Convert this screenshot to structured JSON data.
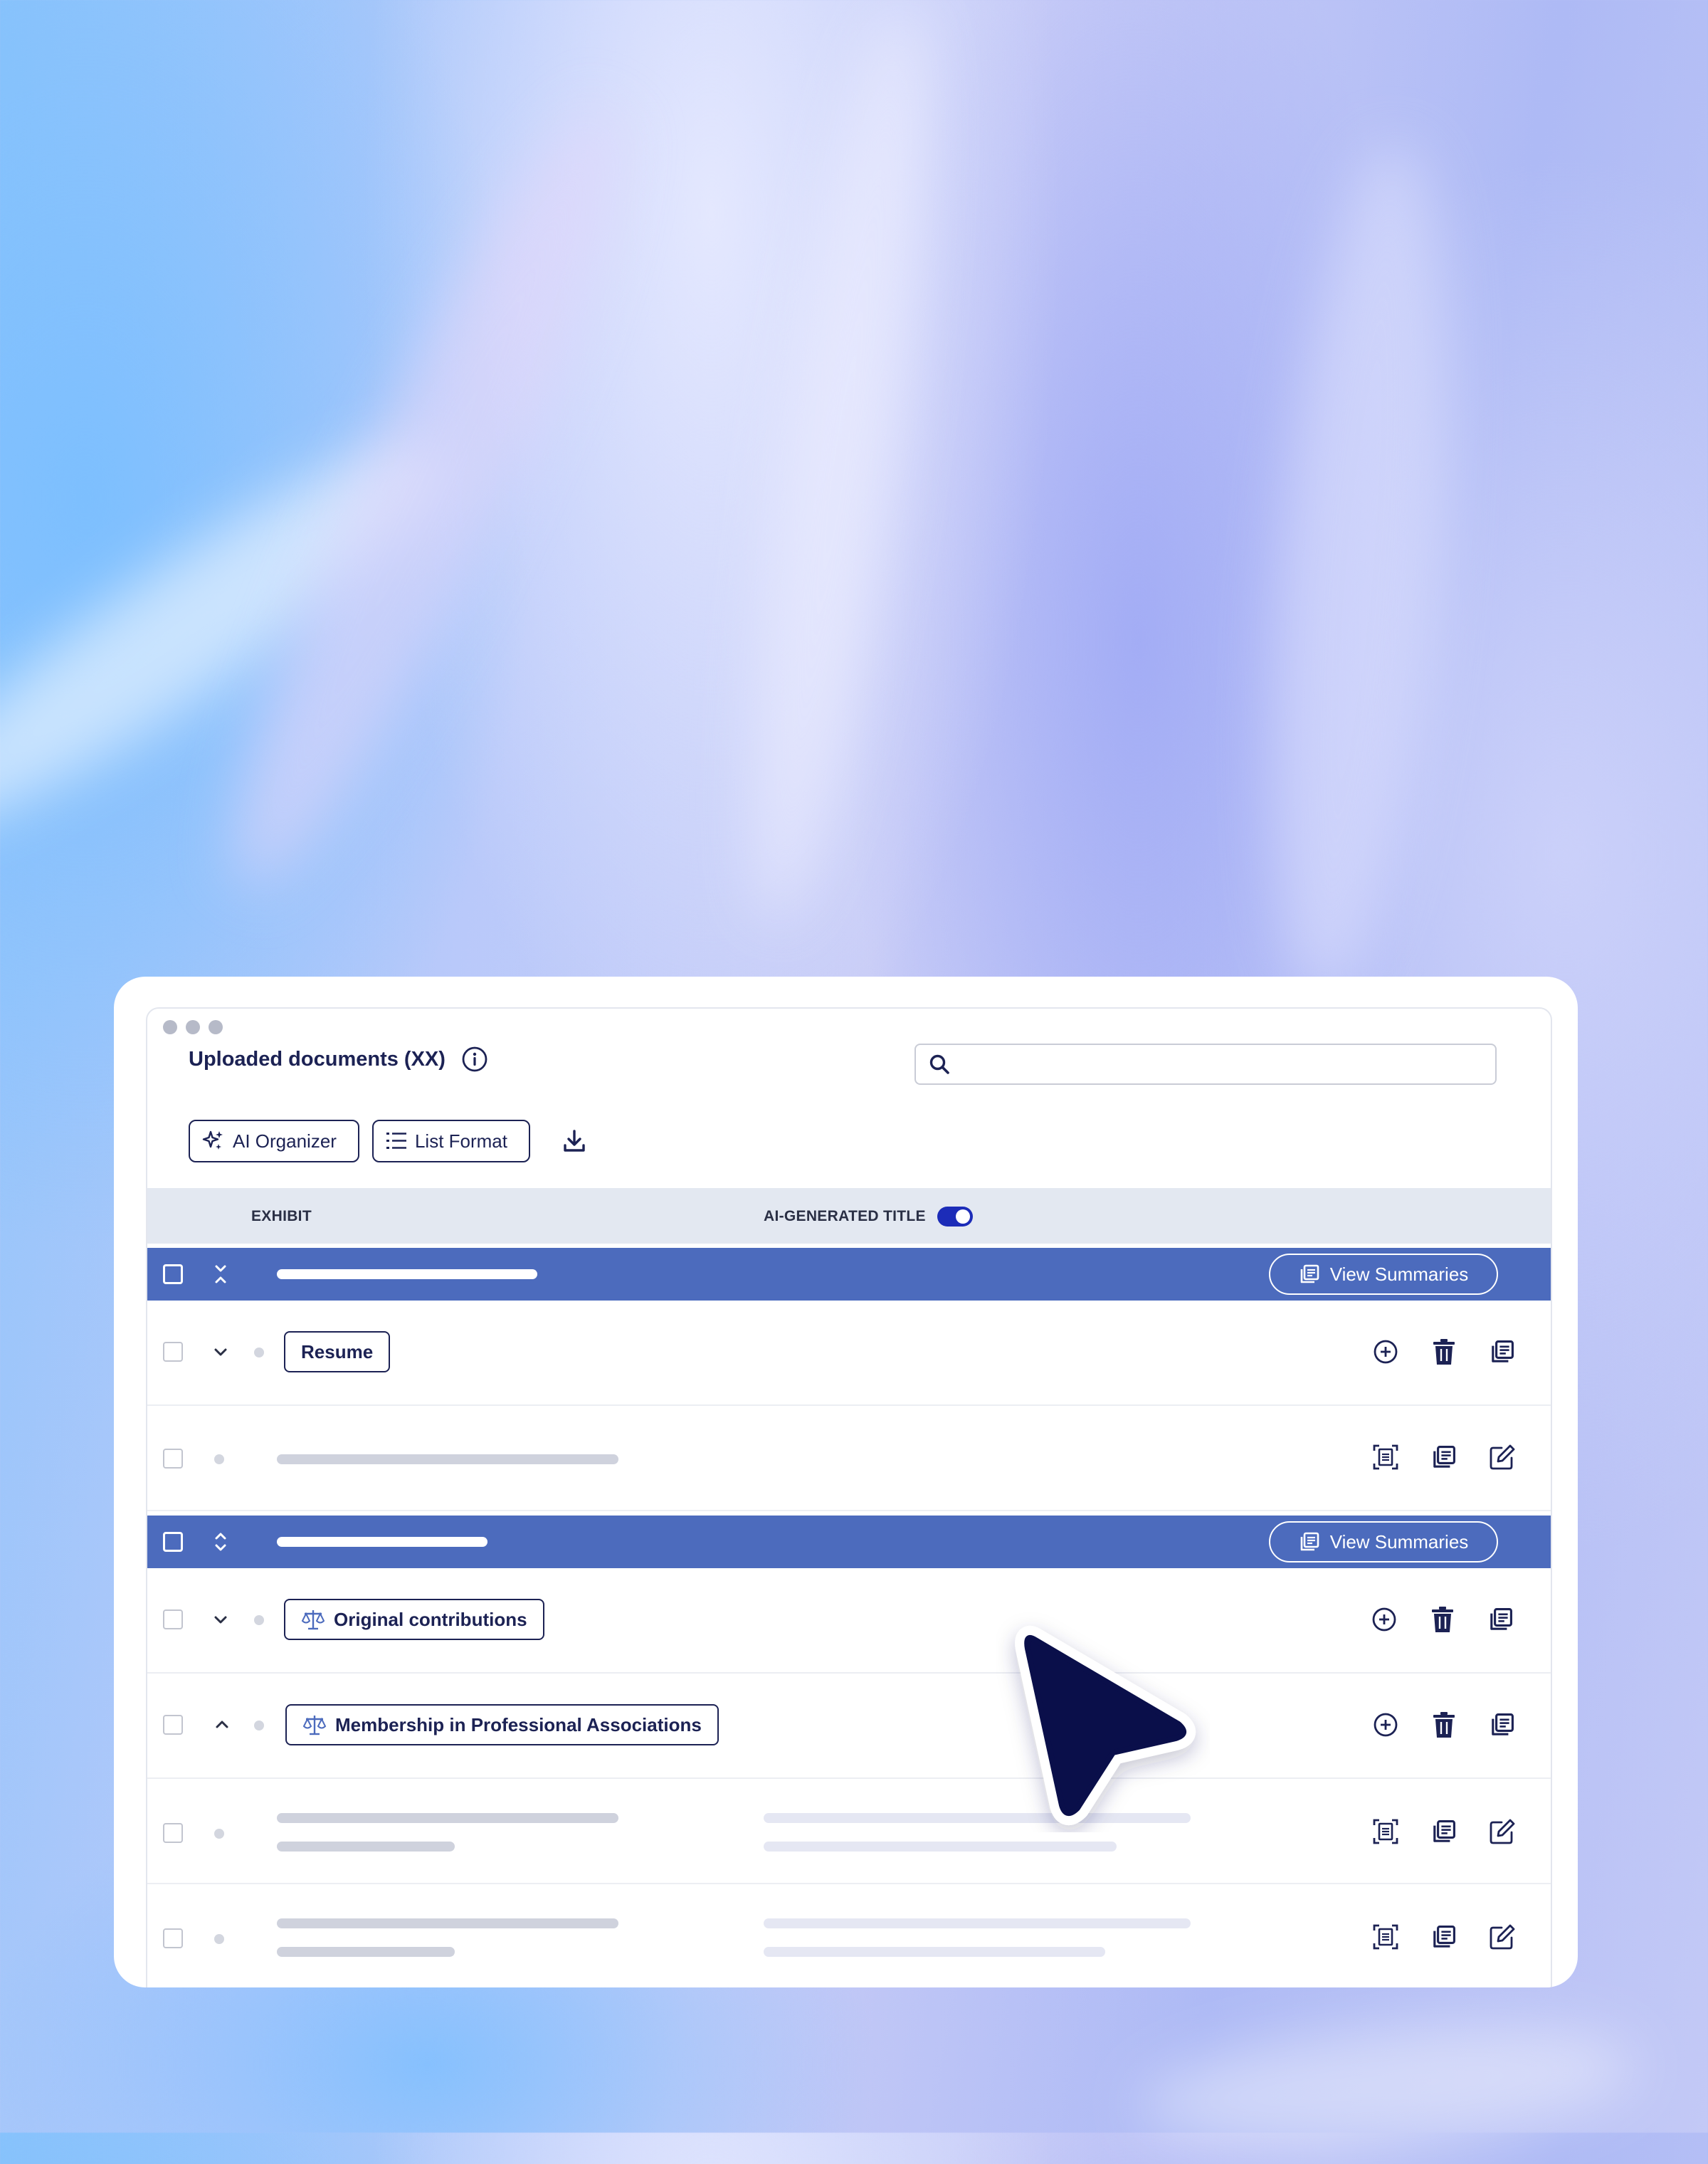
{
  "header": {
    "title": "Uploaded documents (XX)",
    "search_placeholder": ""
  },
  "toolbar": {
    "ai_organizer_label": "AI Organizer",
    "list_format_label": "List Format"
  },
  "table": {
    "col_exhibit": "EXHIBIT",
    "col_ai_title": "AI-GENERATED TITLE",
    "ai_title_toggle_on": true,
    "view_summaries_label": "View Summaries",
    "tags": {
      "resume": "Resume",
      "original_contributions": "Original contributions",
      "membership": "Membership in Professional Associations"
    }
  },
  "colors": {
    "accent_navy": "#1c2254",
    "group_row_blue": "#4c6bbd",
    "toggle_blue": "#1c2cb8"
  }
}
